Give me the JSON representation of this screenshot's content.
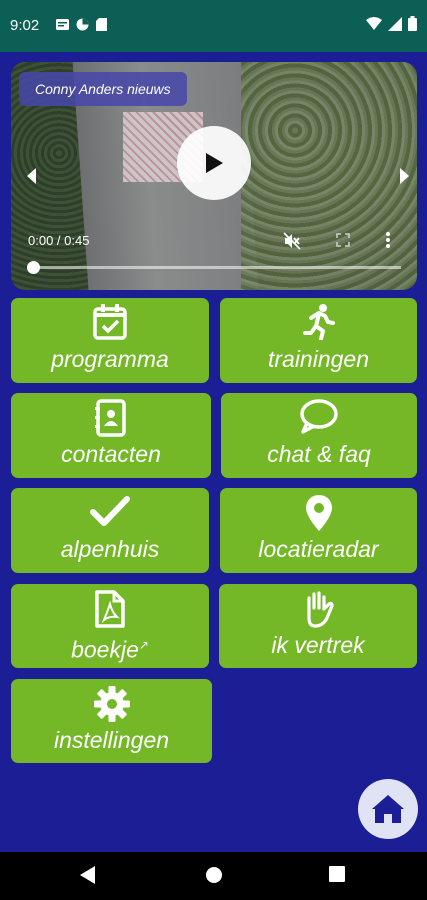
{
  "status_bar": {
    "time": "9:02",
    "left_icons": [
      "message-icon",
      "data-saver-icon",
      "sd-card-icon"
    ],
    "right_icons": [
      "wifi-icon",
      "cellular-signal-icon",
      "battery-icon"
    ]
  },
  "video": {
    "channel_label": "Conny Anders nieuws",
    "timecode": "0:00 / 0:45",
    "progress": 0,
    "muted": true
  },
  "tiles": [
    {
      "label": "programma",
      "icon": "calendar-check-icon"
    },
    {
      "label": "trainingen",
      "icon": "running-person-icon"
    },
    {
      "label": "contacten",
      "icon": "address-book-icon"
    },
    {
      "label": "chat & faq",
      "icon": "chat-bubble-icon"
    },
    {
      "label": "alpenhuis",
      "icon": "checkmark-icon"
    },
    {
      "label": "locatieradar",
      "icon": "location-pin-icon"
    },
    {
      "label": "boekje",
      "icon": "pdf-file-icon",
      "external": true
    },
    {
      "label": "ik vertrek",
      "icon": "hand-stop-icon"
    },
    {
      "label": "instellingen",
      "icon": "gear-icon"
    }
  ],
  "colors": {
    "background": "#1b1e94",
    "tile": "#74b827",
    "status_bar": "#0c5f55",
    "fab": "#dfe3f3",
    "fab_icon": "#1b1e94"
  }
}
